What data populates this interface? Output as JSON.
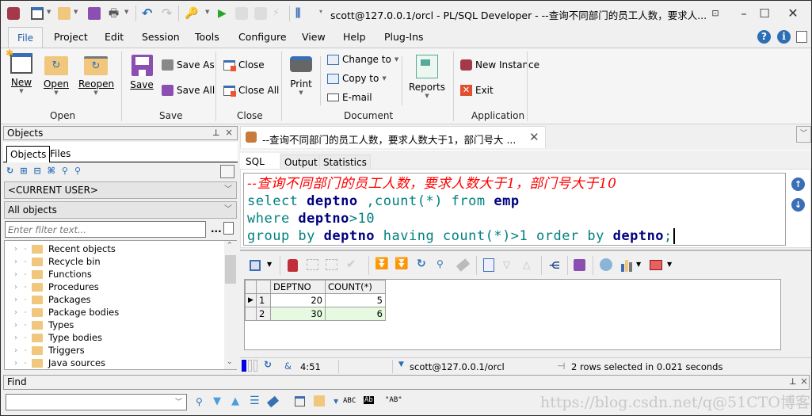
{
  "titlebar": {
    "connection_selector": "scott@127.0.0.1/orcl",
    "title": "scott@127.0.0.1/orcl - PL/SQL Developer - --查询不同部门的员工人数，要求人...",
    "quick_access_icons": [
      "app-db-icon",
      "new-icon",
      "open-icon",
      "save-icon",
      "print-icon",
      "undo-icon",
      "redo-icon",
      "key-icon",
      "execute-icon",
      "commit-icon",
      "rollback-icon",
      "break-icon",
      "customize-icon"
    ]
  },
  "menu": {
    "items": [
      "File",
      "Project",
      "Edit",
      "Session",
      "Tools",
      "Configure",
      "View",
      "Help",
      "Plug-Ins"
    ],
    "active": "File"
  },
  "ribbon": {
    "groups": [
      {
        "label": "Open",
        "buttons": [
          "New",
          "Open",
          "Reopen"
        ]
      },
      {
        "label": "Save",
        "buttons": [
          "Save",
          "Save As",
          "Save All"
        ]
      },
      {
        "label": "Close",
        "buttons": [
          "Close",
          "Close All"
        ]
      },
      {
        "label": "Document",
        "buttons": [
          "Print",
          "Change to",
          "Copy to",
          "E-mail",
          "Reports"
        ]
      },
      {
        "label": "Application",
        "buttons": [
          "New Instance",
          "Exit"
        ]
      }
    ]
  },
  "objects_panel": {
    "title": "Objects",
    "tabs": [
      "Objects",
      "Files"
    ],
    "user_combo": "<CURRENT USER>",
    "filter_combo": "All objects",
    "filter_placeholder": "Enter filter text...",
    "filter_more": "...",
    "tree": [
      "Recent objects",
      "Recycle bin",
      "Functions",
      "Procedures",
      "Packages",
      "Package bodies",
      "Types",
      "Type bodies",
      "Triggers",
      "Java sources"
    ]
  },
  "editor": {
    "doc_tab": "--查询不同部门的员工人数，要求人数大于1，部门号大 ...",
    "subtabs": [
      "SQL",
      "Output",
      "Statistics"
    ],
    "active_subtab": "SQL",
    "lines": {
      "l1": "--查询不同部门的员工人数，要求人数大于1，部门号大于10",
      "l2_a": "select ",
      "l2_b": "deptno",
      "l2_c": " ,count(*) from ",
      "l2_d": "emp",
      "l3_a": "where ",
      "l3_b": "deptno",
      "l3_c": ">10",
      "l4_a": "group by ",
      "l4_b": "deptno",
      "l4_c": " having count(*)>1 order by ",
      "l4_d": "deptno",
      "l4_e": ";"
    }
  },
  "results": {
    "columns": [
      "DEPTNO",
      "COUNT(*)"
    ],
    "rows": [
      {
        "num": "1",
        "deptno": "20",
        "count": "5"
      },
      {
        "num": "2",
        "deptno": "30",
        "count": "6"
      }
    ]
  },
  "statusbar": {
    "position": "4:51",
    "connection": "scott@127.0.0.1/orcl",
    "message": "2 rows selected in 0.021 seconds"
  },
  "find_panel": {
    "title": "Find",
    "input_value": "",
    "opt_abc": "ABC",
    "opt_ab": "Ab",
    "opt_quoted": "\"AB\""
  },
  "watermark": "https://blog.csdn.net/q@51CTO博客"
}
